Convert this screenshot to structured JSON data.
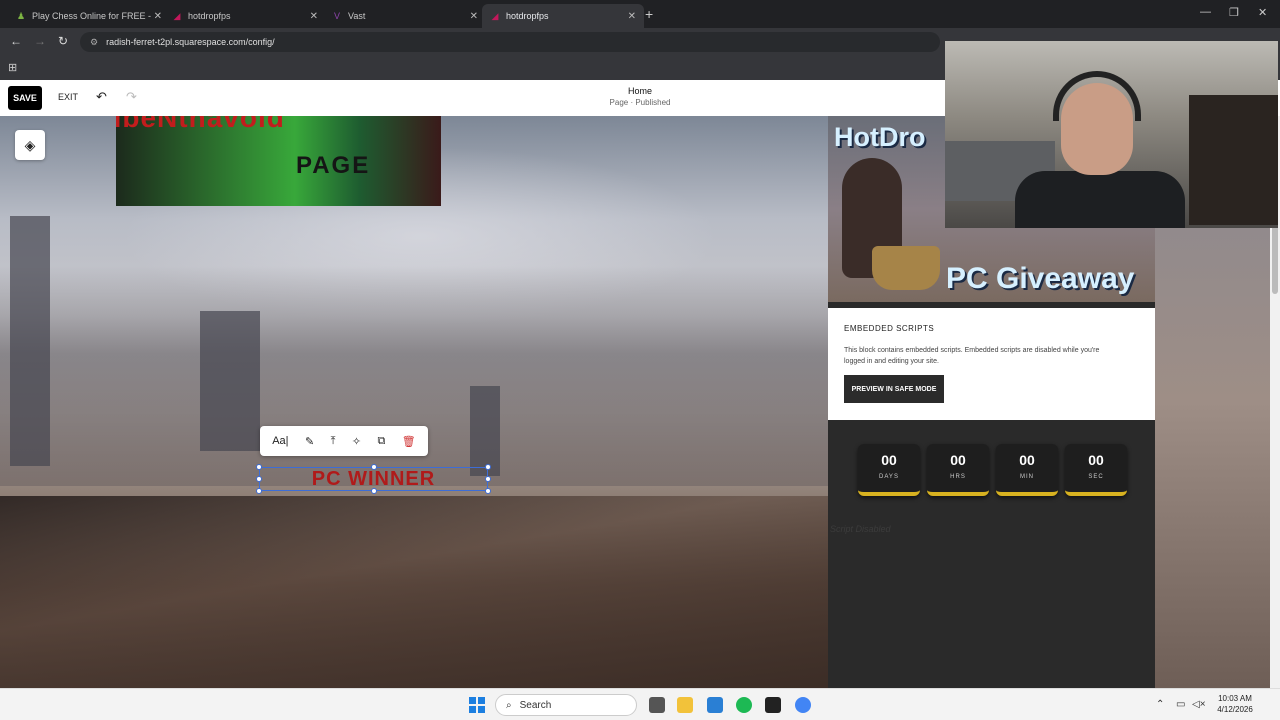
{
  "browser": {
    "tabs": [
      {
        "title": "Play Chess Online for FREE - 2 P",
        "icon_color": "#7cb342",
        "active": false
      },
      {
        "title": "hotdropfps",
        "icon_color": "#c2185b",
        "active": false
      },
      {
        "title": "Vast",
        "icon_color": "#8e44ad",
        "active": false
      },
      {
        "title": "hotdropfps",
        "icon_color": "#c2185b",
        "active": true
      }
    ],
    "new_tab": "+",
    "url": "radish-ferret-t2pl.squarespace.com/config/",
    "minimize": "—",
    "maximize": "❐",
    "close": "✕"
  },
  "editor": {
    "save_label": "SAVE",
    "exit_label": "EXIT",
    "page_name": "Home",
    "page_status": "Page · Published"
  },
  "banner": {
    "red_text": "TibeNthavold",
    "page_text": "PAGE"
  },
  "text_block": {
    "text": "PC WINNER",
    "tools": [
      "Aa|",
      "✎",
      "⤒",
      "✧",
      "⧉",
      "🗑"
    ]
  },
  "promo": {
    "top_text": "HotDro",
    "bottom_text": "PC Giveaway"
  },
  "embed": {
    "heading": "EMBEDDED SCRIPTS",
    "body": "This block contains embedded scripts. Embedded scripts are disabled while you're logged in and editing your site.",
    "button": "PREVIEW IN SAFE MODE"
  },
  "countdown": [
    {
      "value": "00",
      "label": "DAYS"
    },
    {
      "value": "00",
      "label": "HRS"
    },
    {
      "value": "00",
      "label": "MIN"
    },
    {
      "value": "00",
      "label": "SEC"
    }
  ],
  "script_disabled": "Script Disabled",
  "taskbar": {
    "search_label": "Search",
    "time": "10:03 AM",
    "date": "4/12/2026"
  }
}
